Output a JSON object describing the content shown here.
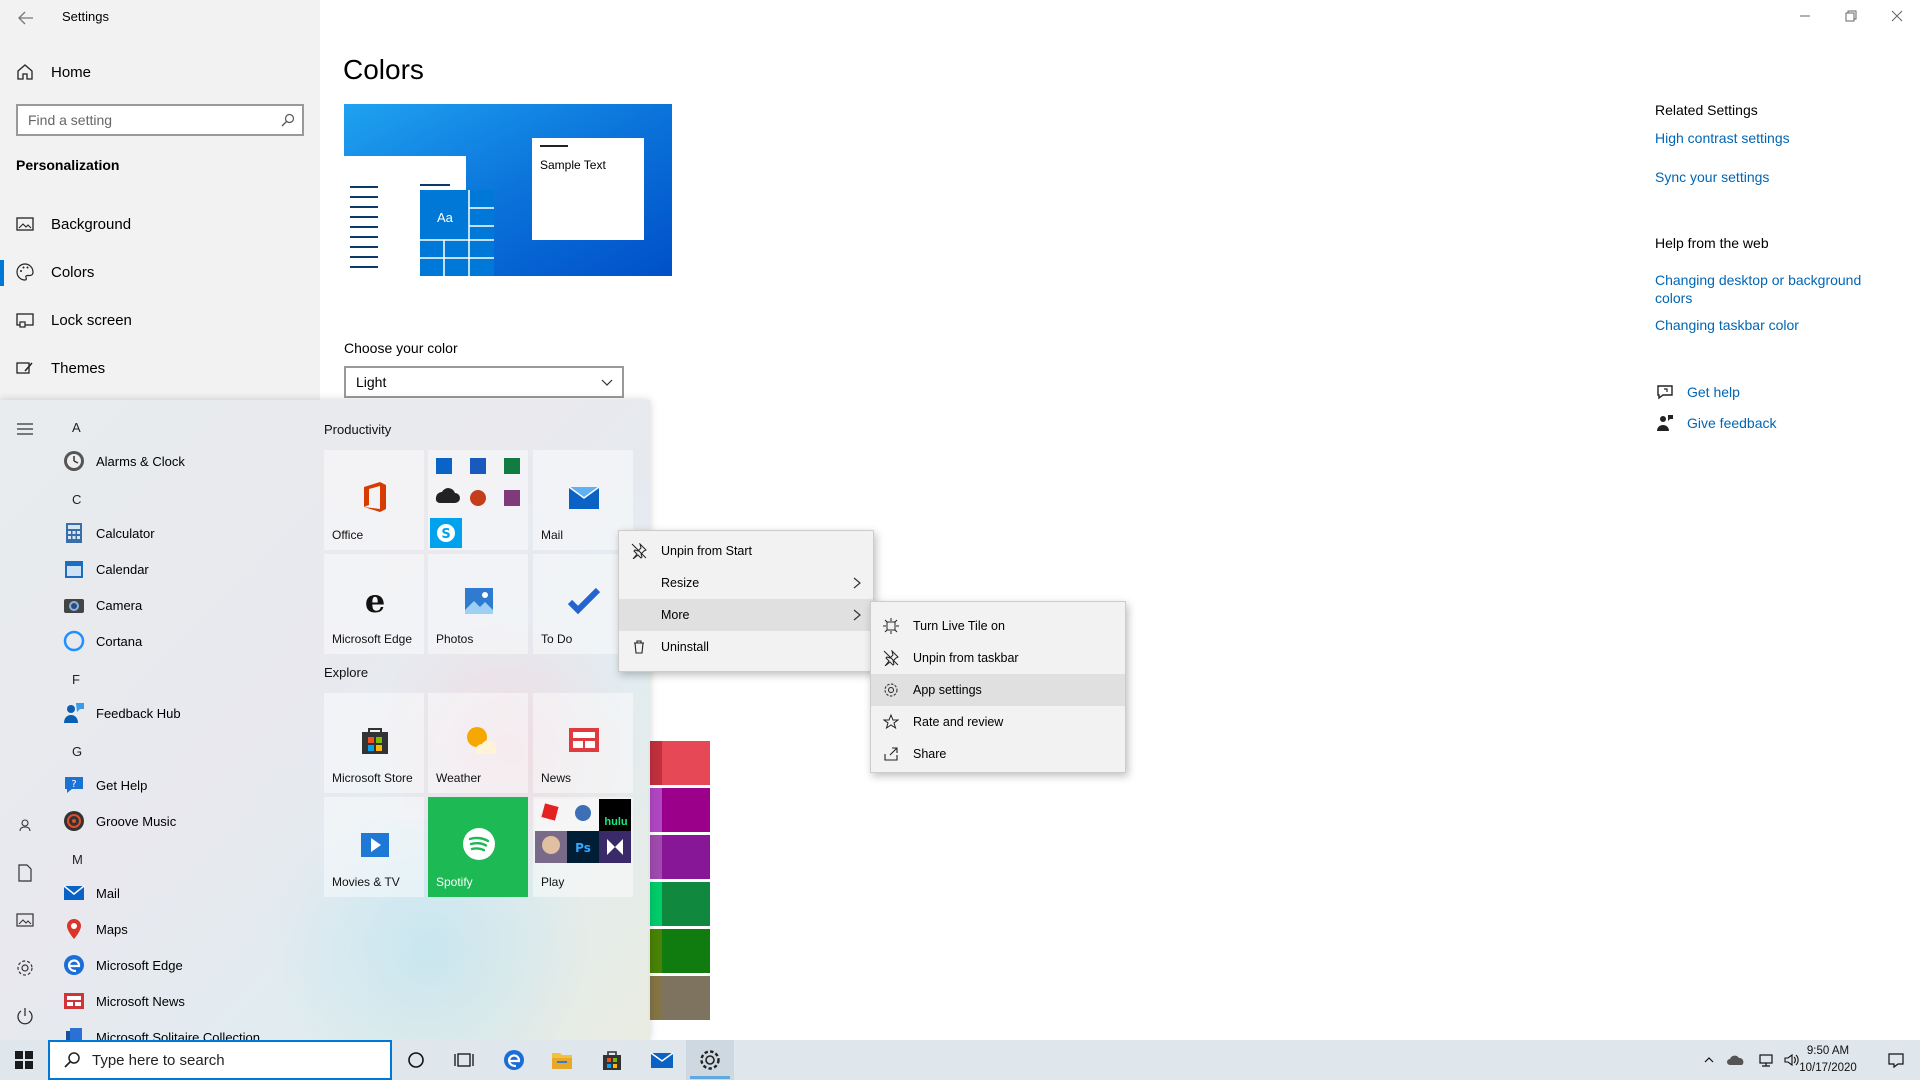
{
  "window": {
    "title": "Settings"
  },
  "sidebar": {
    "home_label": "Home",
    "search_placeholder": "Find a setting",
    "section_heading": "Personalization",
    "items": [
      {
        "label": "Background"
      },
      {
        "label": "Colors"
      },
      {
        "label": "Lock screen"
      },
      {
        "label": "Themes"
      }
    ],
    "active_item": "Colors"
  },
  "main": {
    "title": "Colors",
    "preview_sample_text": "Sample Text",
    "preview_tile_text": "Aa",
    "choose_color_label": "Choose your color",
    "choose_color_value": "Light",
    "accent_color": "#0078d7"
  },
  "related": {
    "title": "Related Settings",
    "links": [
      "High contrast settings",
      "Sync your settings"
    ],
    "help_title": "Help from the web",
    "help_links": [
      "Changing desktop or background colors",
      "Changing taskbar color"
    ],
    "get_help": "Get help",
    "give_feedback": "Give feedback"
  },
  "start_menu": {
    "letters": [
      "A",
      "C",
      "F",
      "G",
      "M"
    ],
    "apps": [
      {
        "label": "Alarms & Clock"
      },
      {
        "label": "Calculator"
      },
      {
        "label": "Calendar"
      },
      {
        "label": "Camera"
      },
      {
        "label": "Cortana"
      },
      {
        "label": "Feedback Hub"
      },
      {
        "label": "Get Help"
      },
      {
        "label": "Groove Music"
      },
      {
        "label": "Mail"
      },
      {
        "label": "Maps"
      },
      {
        "label": "Microsoft Edge"
      },
      {
        "label": "Microsoft News"
      },
      {
        "label": "Microsoft Solitaire Collection"
      }
    ],
    "groups": [
      "Productivity",
      "Explore"
    ],
    "tiles": {
      "office": "Office",
      "mail": "Mail",
      "edge": "Microsoft Edge",
      "photos": "Photos",
      "todo": "To Do",
      "store": "Microsoft Store",
      "weather": "Weather",
      "news": "News",
      "movies": "Movies & TV",
      "spotify": "Spotify",
      "play": "Play",
      "hulu": "hulu"
    }
  },
  "context_menu": {
    "items": [
      {
        "label": "Unpin from Start"
      },
      {
        "label": "Resize"
      },
      {
        "label": "More"
      },
      {
        "label": "Uninstall"
      }
    ],
    "submenu": [
      {
        "label": "Turn Live Tile on"
      },
      {
        "label": "Unpin from taskbar"
      },
      {
        "label": "App settings"
      },
      {
        "label": "Rate and review"
      },
      {
        "label": "Share"
      }
    ]
  },
  "taskbar": {
    "search_placeholder": "Type here to search",
    "time": "9:50 AM",
    "date": "10/17/2020"
  }
}
